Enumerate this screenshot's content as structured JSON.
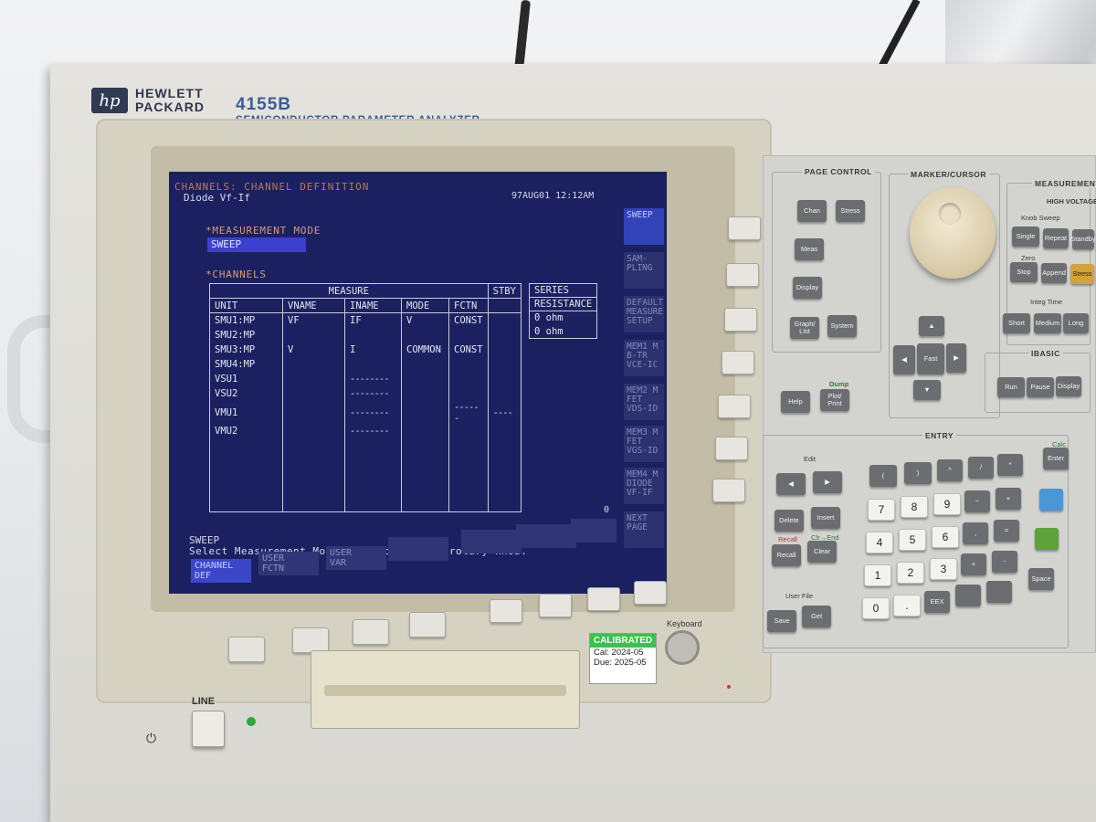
{
  "brand": {
    "logo": "hp",
    "maker_line1": "HEWLETT",
    "maker_line2": "PACKARD",
    "model": "4155B",
    "description": "SEMICONDUCTOR PARAMETER ANALYZER"
  },
  "screen": {
    "title": "CHANNELS: CHANNEL DEFINITION",
    "setup_name": "Diode Vf-If",
    "datetime": "97AUG01 12:12AM",
    "measurement_mode_heading": "*MEASUREMENT MODE",
    "measurement_mode_value": "SWEEP",
    "channels_heading": "*CHANNELS",
    "table": {
      "group_headers": {
        "measure": "MEASURE",
        "stby": "STBY"
      },
      "columns": [
        "UNIT",
        "VNAME",
        "INAME",
        "MODE",
        "FCTN"
      ],
      "rows": [
        {
          "unit": "SMU1:MP",
          "vname": "VF",
          "iname": "IF",
          "mode": "V",
          "fctn": "CONST"
        },
        {
          "unit": "SMU2:MP",
          "vname": "",
          "iname": "",
          "mode": "",
          "fctn": ""
        },
        {
          "unit": "SMU3:MP",
          "vname": "V",
          "iname": "I",
          "mode": "COMMON",
          "fctn": "CONST"
        },
        {
          "unit": "SMU4:MP",
          "vname": "",
          "iname": "",
          "mode": "",
          "fctn": ""
        },
        {
          "unit": "VSU1",
          "vname": "",
          "iname": "--------",
          "mode": "",
          "fctn": ""
        },
        {
          "unit": "VSU2",
          "vname": "",
          "iname": "--------",
          "mode": "",
          "fctn": ""
        },
        {
          "unit": "VMU1",
          "vname": "",
          "iname": "--------",
          "mode": "",
          "fctn": "------",
          "stby": "----"
        },
        {
          "unit": "VMU2",
          "vname": "",
          "iname": "--------",
          "mode": "",
          "fctn": ""
        }
      ],
      "series_header_1": "SERIES",
      "series_header_2": "RESISTANCE",
      "series_values": [
        "0 ohm",
        "0 ohm"
      ]
    },
    "corner_value": "0",
    "status_line": "SWEEP",
    "message_line": "Select Measurement Mode with softkey or rotary knob.",
    "bottom_softkeys": [
      {
        "line1": "CHANNEL",
        "line2": "DEF",
        "active": true
      },
      {
        "line1": "USER",
        "line2": "FCTN"
      },
      {
        "line1": "USER",
        "line2": "VAR"
      },
      {
        "line1": "",
        "line2": ""
      },
      {
        "line1": "",
        "line2": ""
      },
      {
        "line1": "",
        "line2": ""
      },
      {
        "line1": "",
        "line2": ""
      }
    ],
    "right_softkeys": [
      "SWEEP",
      "SAM- PLING",
      "DEFAULT MEASURE SETUP",
      "MEM1 M B-Tr VCE-IC",
      "MEM2 M FET VDS-ID",
      "MEM3 M FET VGS-ID",
      "MEM4 M DIODE VF-IF",
      "NEXT PAGE"
    ]
  },
  "panel": {
    "page_control": {
      "label": "PAGE CONTROL",
      "keys": [
        "Chan",
        "Stress",
        "Meas",
        "Display",
        "Graph/ List",
        "System"
      ]
    },
    "marker_cursor": {
      "label": "MARKER/CURSOR",
      "fast": "Fast"
    },
    "help_keys": {
      "help": "Help",
      "plot": "Plot/ Print",
      "dump": "Dump"
    },
    "measurement": {
      "label": "MEASUREMENT",
      "high_voltage": "HIGH VOLTAGE",
      "knob_sweep": "Knob Sweep",
      "zero": "Zero",
      "keys": [
        "Single",
        "Repeat",
        "Standby",
        "Stop",
        "Append",
        "Stress"
      ]
    },
    "integ_time": {
      "label": "Integ Time",
      "keys": [
        "Short",
        "Medium",
        "Long"
      ]
    },
    "ibasic": {
      "label": "IBASIC",
      "keys": [
        "Run",
        "Pause",
        "Display"
      ]
    },
    "entry": {
      "label": "ENTRY",
      "edit": "Edit",
      "calc": "Calc",
      "enter": "Enter",
      "delete": "Delete",
      "insert": "Insert",
      "recall": "Recall",
      "clear": "Clear",
      "recall_label": "Recall",
      "clr_end": "Clr→End",
      "user_file": "User File",
      "save": "Save",
      "get": "Get",
      "space": "Space",
      "eex": "EEX",
      "numbers": [
        "7",
        "8",
        "9",
        "4",
        "5",
        "6",
        "1",
        "2",
        "3",
        "0",
        "."
      ]
    }
  },
  "front": {
    "keyboard": "Keyboard",
    "line": "LINE",
    "calibrated": "CALIBRATED",
    "cal": "Cal: 2024-05",
    "due": "Due: 2025-05"
  }
}
